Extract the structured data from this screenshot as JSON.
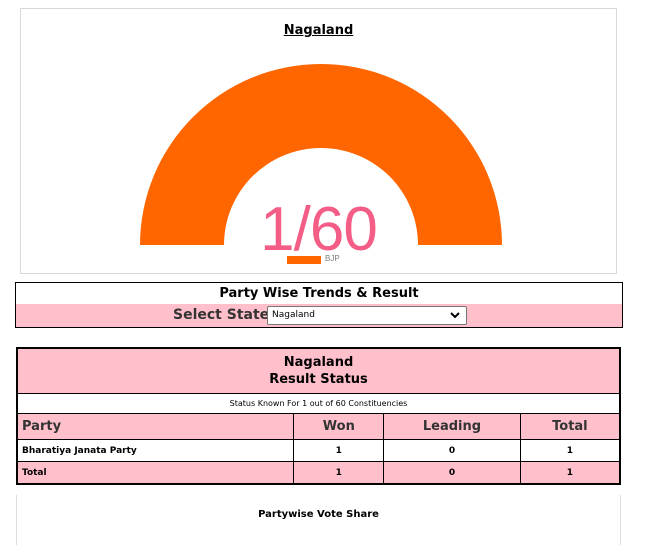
{
  "gauge": {
    "title": "Nagaland",
    "value_text": "1/60",
    "won": 1,
    "total_seats": 60,
    "color": "#ff6600",
    "value_color": "#f35d86",
    "legend": [
      {
        "label": "BJP",
        "color": "#ff6600"
      }
    ]
  },
  "trends": {
    "title": "Party Wise Trends & Result",
    "select_label": "Select State",
    "selected_state": "Nagaland"
  },
  "result": {
    "state": "Nagaland",
    "heading": "Result Status",
    "status_note": "Status Known For 1 out of 60 Constituencies",
    "columns": [
      "Party",
      "Won",
      "Leading",
      "Total"
    ],
    "rows": [
      {
        "party": "Bharatiya Janata Party",
        "won": "1",
        "leading": "0",
        "total": "1"
      }
    ],
    "total_row": {
      "party": "Total",
      "won": "1",
      "leading": "0",
      "total": "1"
    }
  },
  "vote_share": {
    "title": "Partywise Vote Share"
  }
}
